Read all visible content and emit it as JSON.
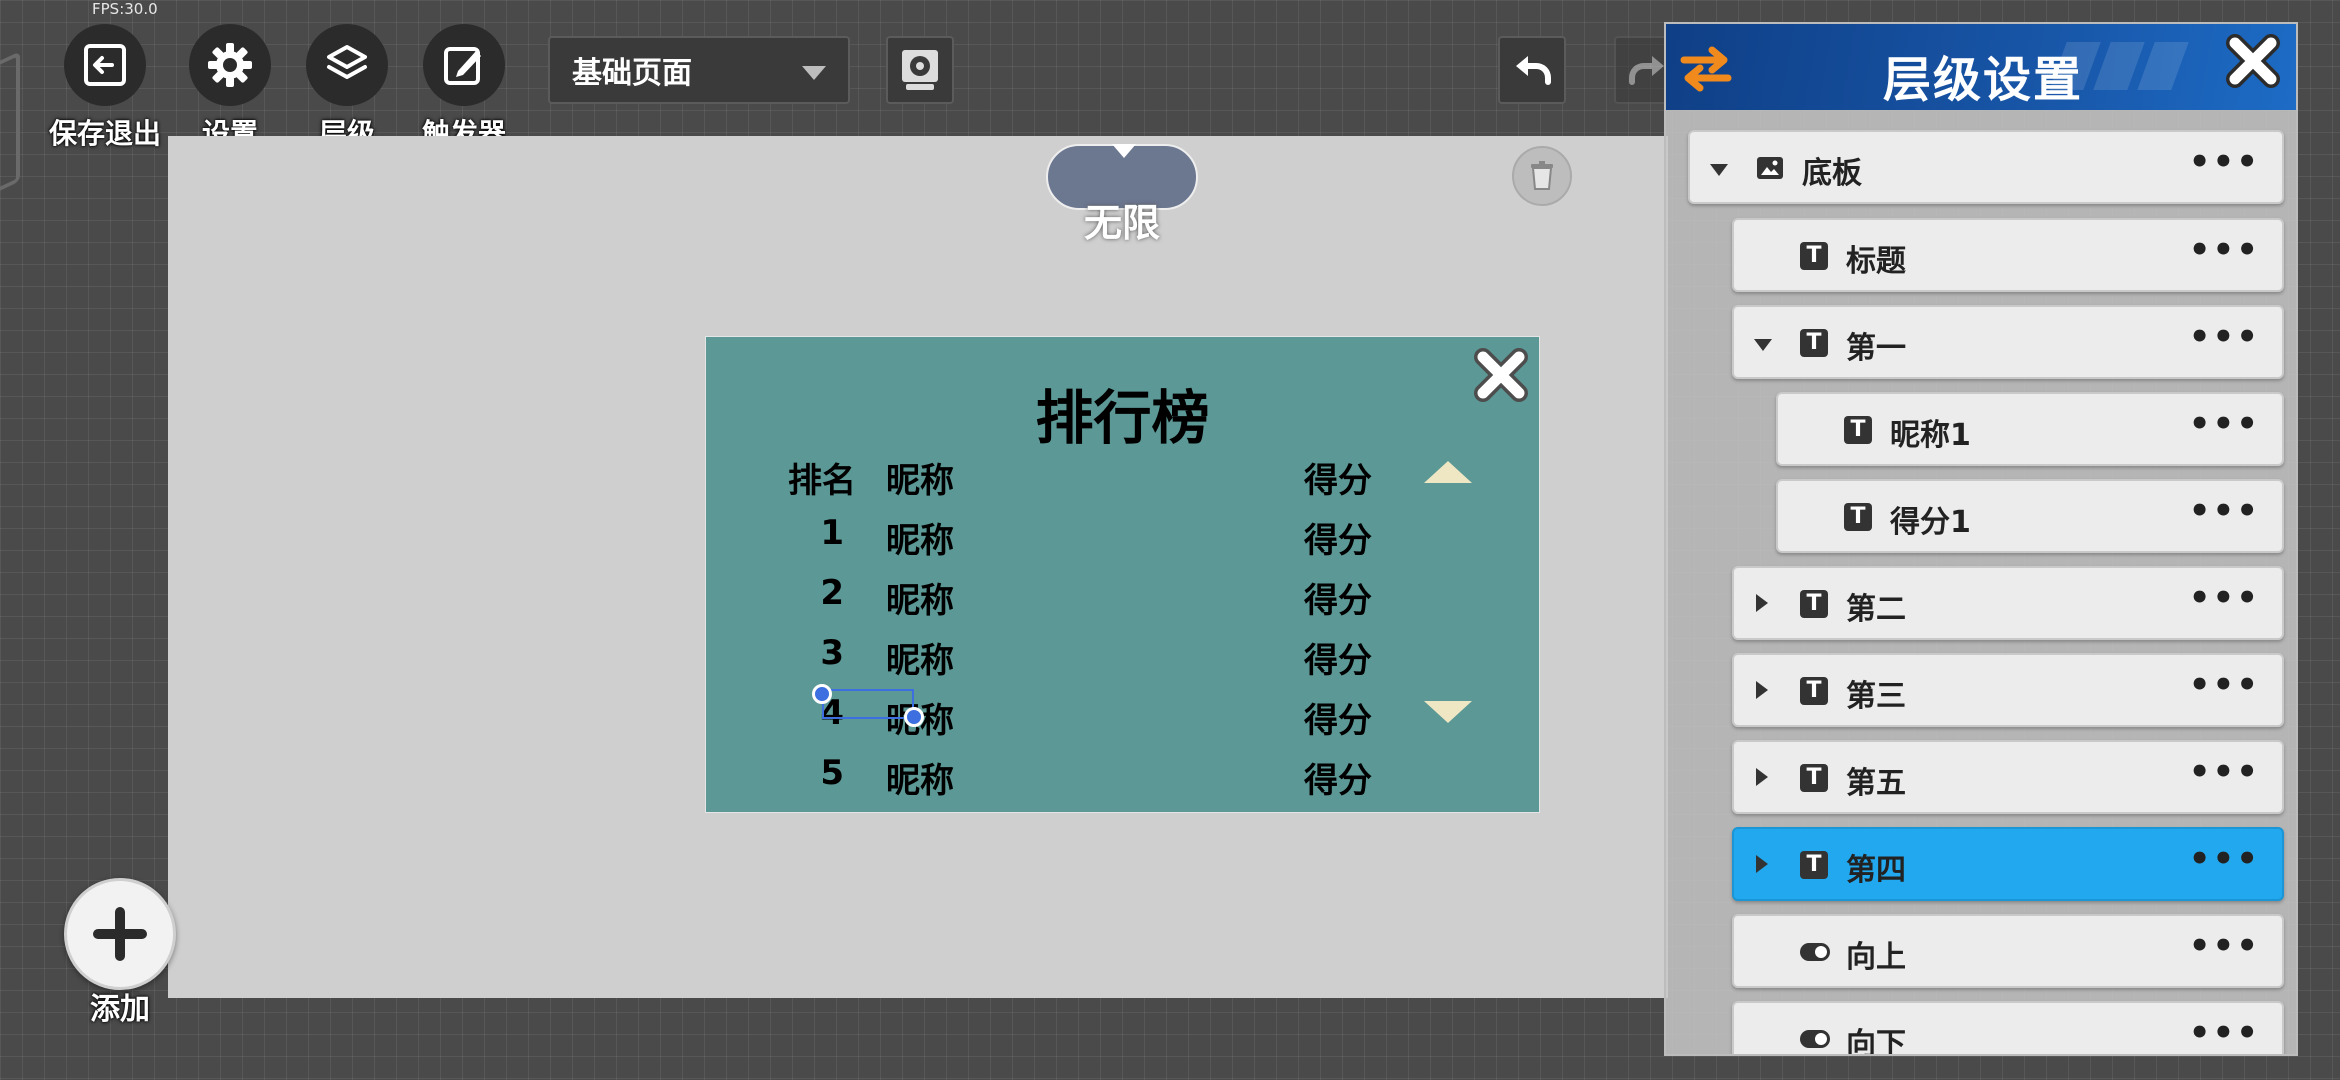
{
  "status": {
    "fps": "FPS:30.0"
  },
  "toolbar": {
    "save_exit": "保存退出",
    "settings": "设置",
    "layers": "层级",
    "trigger": "触发器",
    "page_select_value": "基础页面"
  },
  "canvas": {
    "size_mode": "无限"
  },
  "leaderboard": {
    "title": "排行榜",
    "header": {
      "rank": "排名",
      "name": "昵称",
      "score": "得分"
    },
    "rows": [
      {
        "rank": "1",
        "name": "昵称",
        "score": "得分"
      },
      {
        "rank": "2",
        "name": "昵称",
        "score": "得分"
      },
      {
        "rank": "3",
        "name": "昵称",
        "score": "得分"
      },
      {
        "rank": "4",
        "name": "昵称",
        "score": "得分"
      },
      {
        "rank": "5",
        "name": "昵称",
        "score": "得分"
      }
    ]
  },
  "add": {
    "label": "添加"
  },
  "layer_panel": {
    "title": "层级设置",
    "more_label": "•••",
    "items": [
      {
        "label": "底板",
        "icon": "image-icon",
        "expander": "expanded"
      },
      {
        "label": "标题",
        "icon": "text-icon",
        "expander": "none"
      },
      {
        "label": "第一",
        "icon": "text-icon",
        "expander": "expanded"
      },
      {
        "label": "昵称1",
        "icon": "text-icon",
        "expander": "none"
      },
      {
        "label": "得分1",
        "icon": "text-icon",
        "expander": "none"
      },
      {
        "label": "第二",
        "icon": "text-icon",
        "expander": "collapsed"
      },
      {
        "label": "第三",
        "icon": "text-icon",
        "expander": "collapsed"
      },
      {
        "label": "第五",
        "icon": "text-icon",
        "expander": "collapsed"
      },
      {
        "label": "第四",
        "icon": "text-icon",
        "expander": "collapsed",
        "selected": true
      },
      {
        "label": "向上",
        "icon": "toggle-icon",
        "expander": "none"
      },
      {
        "label": "向下",
        "icon": "toggle-icon",
        "expander": "none"
      }
    ]
  },
  "colors": {
    "board": "#5b9896",
    "panel_header": "#1856a8",
    "selected_layer": "#22a8ee",
    "swap_icon": "#f08a1c"
  }
}
